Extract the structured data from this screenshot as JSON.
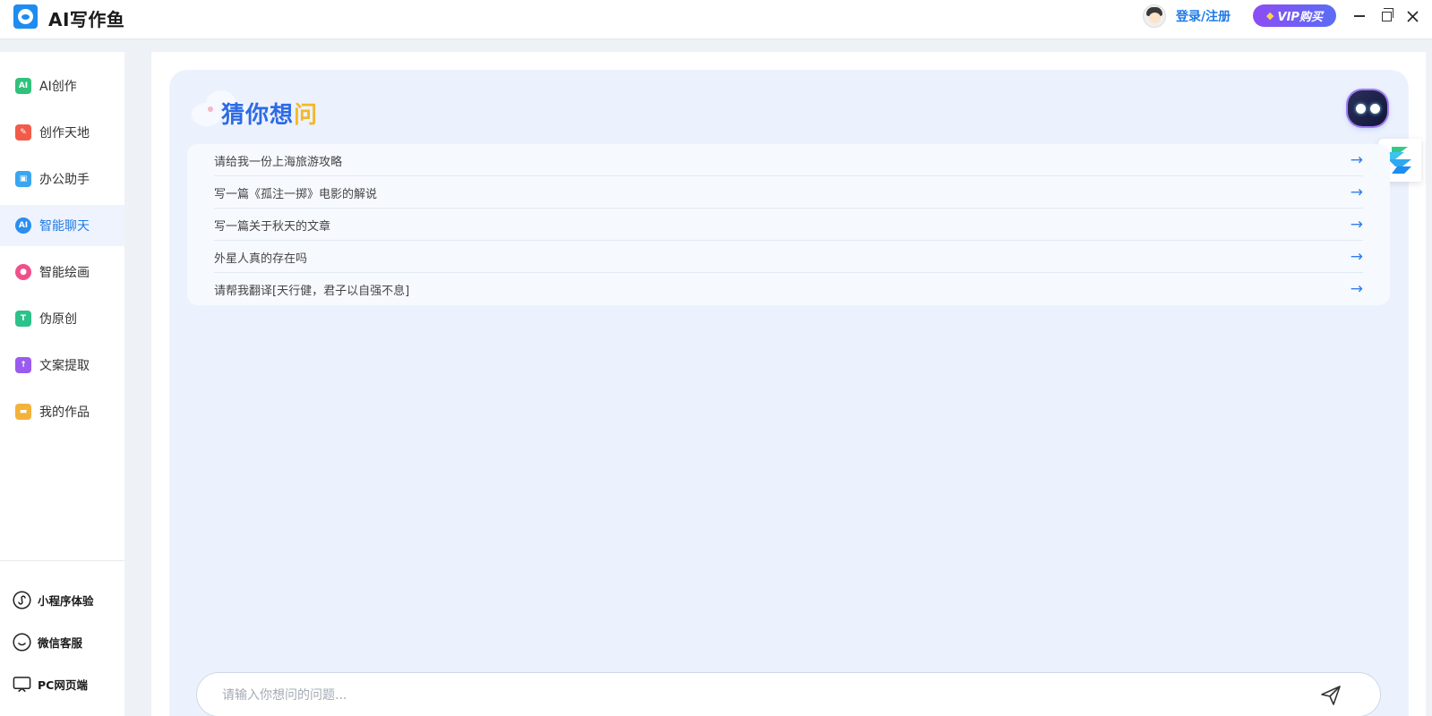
{
  "app": {
    "title": "AI写作鱼"
  },
  "header": {
    "login_label": "登录/注册",
    "vip_label": "VIP购买",
    "vip_icon": "gem-icon"
  },
  "sidebar": {
    "items": [
      {
        "label": "AI创作",
        "icon": "ai-create-icon",
        "color": "#2fc27a",
        "active": false
      },
      {
        "label": "创作天地",
        "icon": "pen-icon",
        "color": "#f25a4a",
        "active": false
      },
      {
        "label": "办公助手",
        "icon": "briefcase-icon",
        "color": "#3aa6f0",
        "active": false
      },
      {
        "label": "智能聊天",
        "icon": "chat-icon",
        "color": "#2a8ef0",
        "active": true
      },
      {
        "label": "智能绘画",
        "icon": "palette-icon",
        "color": "#f0508a",
        "active": false
      },
      {
        "label": "伪原创",
        "icon": "rewrite-icon",
        "color": "#2cc28a",
        "active": false
      },
      {
        "label": "文案提取",
        "icon": "upload-folder-icon",
        "color": "#9a5cf0",
        "active": false
      },
      {
        "label": "我的作品",
        "icon": "folder-icon",
        "color": "#f3b23a",
        "active": false
      }
    ],
    "footer": [
      {
        "label": "小程序体验",
        "icon": "miniprogram-icon"
      },
      {
        "label": "微信客服",
        "icon": "wechat-service-icon"
      },
      {
        "label": "PC网页端",
        "icon": "desktop-icon"
      }
    ]
  },
  "chat": {
    "guess_title_main": "猜你想",
    "guess_title_accent": "问",
    "suggestions": [
      "请给我一份上海旅游攻略",
      "写一篇《孤注一掷》电影的解说",
      "写一篇关于秋天的文章",
      "外星人真的存在吗",
      "请帮我翻译[天行健，君子以自强不息]"
    ],
    "input_placeholder": "请输入你想问的问题..."
  },
  "colors": {
    "accent": "#1e7ae6",
    "panel": "#ecf2fd",
    "vip_start": "#8d4cf5",
    "vip_end": "#5a6df5"
  }
}
